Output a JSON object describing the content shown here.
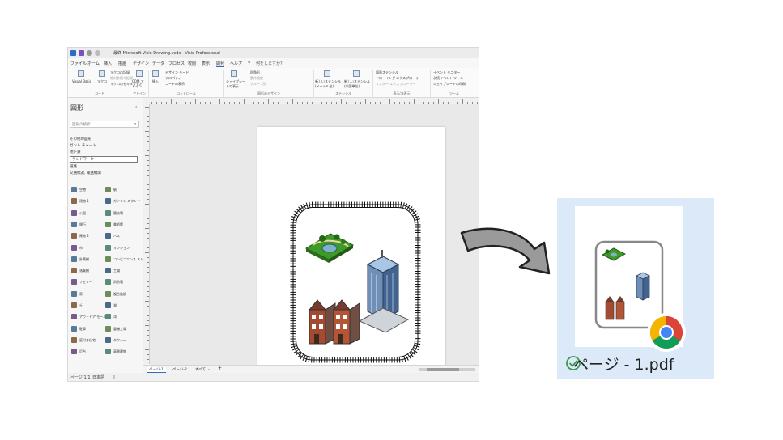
{
  "visio": {
    "title": "最終 Microsoft Visio Drawing.vsdx - Visio Professional",
    "menu": [
      "ファイル",
      "ホーム",
      "挿入",
      "描画",
      "デザイン",
      "データ",
      "プロセス",
      "校閲",
      "表示",
      "開発",
      "ヘルプ"
    ],
    "search_placeholder": "何をしますか?",
    "ribbon": {
      "visual_basic": "Visual Basic",
      "macro": "マクロ",
      "record_macro": "マクロの記録",
      "relative_ref": "相対参照で記録",
      "macro_security": "マクロのセキュリティ",
      "group_code": "コード",
      "com_addin": "COM アドイン",
      "group_addin": "アドイン",
      "insert": "挿入",
      "design_mode": "デザイン モード",
      "properties": "プロパティ",
      "view_code": "コードの表示",
      "group_controls": "コントロール",
      "shapesheet": "シェイプシートの表示",
      "rectangle": "四角形",
      "behavior": "動作設定",
      "group_shape": "グループ化",
      "group_shape_design": "図形のデザイン",
      "new_stencil_metric": "新しいステンシル (メートル法)",
      "new_stencil_us": "新しいステンシル (米国単位)",
      "group_stencil": "ステンシル",
      "doc_stencil": "図面ステンシル",
      "drawing_explorer": "ドローイング エクスプローラー",
      "master_explorer": "マスター エクスプローラー",
      "group_show": "表示/非表示",
      "event_monitor": "イベント モニター",
      "event_tool": "永続イベント ツール",
      "shapesheet_edit": "シェイプシートの印刷",
      "group_tools": "ツール"
    },
    "shapes_pane": {
      "title": "図形",
      "search_placeholder": "図形の検索",
      "more_shapes": "その他の図形",
      "stencils": [
        "ガント チャート",
        "地下鉄",
        "ランドマーク",
        "道路",
        "交通標識, 輸送機関"
      ],
      "items": [
        "空港",
        "駅",
        "建物 1",
        "ガソリン スタンド",
        "公園",
        "競技場",
        "銀行",
        "美術館",
        "建物 2",
        "バス",
        "市",
        "マンション",
        "針葉樹",
        "コンビニエンス ストア",
        "落葉樹",
        "工場",
        "フェリー",
        "消防署",
        "家",
        "複合施設",
        "丘",
        "湖",
        "アウトドア モール",
        "湾",
        "駐車",
        "重機工場",
        "庭付き住宅",
        "タクシー",
        "灯台",
        "高層建物"
      ]
    },
    "tabs": [
      "ページ-1",
      "ページ-2",
      "すべて",
      "+"
    ],
    "status": [
      "ページ 1/1",
      "日本語"
    ]
  },
  "pdf": {
    "filename": "ページ - 1.pdf",
    "status_icon": "check-circle-icon",
    "app_icon": "chrome-icon"
  },
  "colors": {
    "pdf_card_bg": "#dbe9f8",
    "check_green": "#3a9a4a",
    "ribbon_bg": "#fafafa"
  }
}
